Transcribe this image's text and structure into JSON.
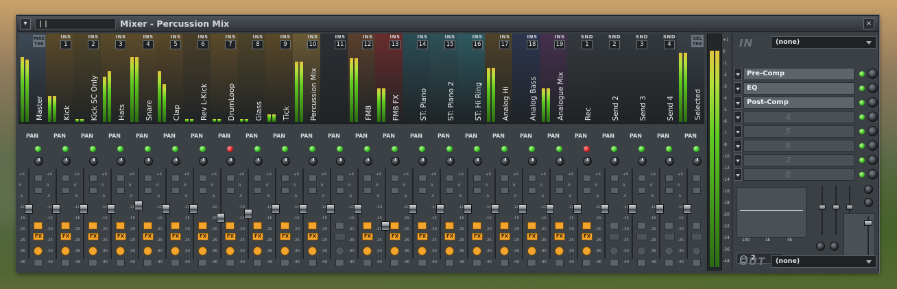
{
  "window": {
    "title": "Mixer - Percussion Mix",
    "close_icon": "×",
    "menu_icon": "▾"
  },
  "labels": {
    "pan": "PAN",
    "ins": "INS",
    "snd": "SND",
    "fx": "FX",
    "master_tag": "MAS TER",
    "sel_tag": "SEL TRK"
  },
  "colors": {
    "accent_orange": "#f2a42d",
    "meter_green": "#5fcb20",
    "led_green": "#2fb81a",
    "led_red": "#d61a1a"
  },
  "channels": [
    {
      "name": "Master",
      "tag": "MAS TER",
      "num": "",
      "color": "#3d4a55",
      "led": "green",
      "fader": 0.56,
      "fx": true,
      "meter": [
        0.86,
        0.83
      ]
    },
    {
      "name": "Kick",
      "tag": "INS",
      "num": "1",
      "color": "#5c4a2a",
      "led": "green",
      "fader": 0.56,
      "fx": true,
      "meter": [
        0.35,
        0.35
      ]
    },
    {
      "name": "Kick SC Only",
      "tag": "INS",
      "num": "2",
      "color": "#4f4528",
      "led": "green",
      "fader": 0.56,
      "fx": true,
      "meter": [
        0.04,
        0.04
      ]
    },
    {
      "name": "Hats",
      "tag": "INS",
      "num": "3",
      "color": "#5a4a28",
      "led": "green",
      "fader": 0.56,
      "fx": true,
      "meter": [
        0.6,
        0.67
      ]
    },
    {
      "name": "Snare",
      "tag": "INS",
      "num": "4",
      "color": "#5d4b2a",
      "led": "green",
      "fader": 0.6,
      "fx": true,
      "meter": [
        0.86,
        0.86
      ]
    },
    {
      "name": "Clap",
      "tag": "INS",
      "num": "5",
      "color": "#5a4828",
      "led": "green",
      "fader": 0.56,
      "fx": true,
      "meter": [
        0.67,
        0.5
      ]
    },
    {
      "name": "Rev L-Kick",
      "tag": "INS",
      "num": "6",
      "color": "#4a3f28",
      "led": "green",
      "fader": 0.56,
      "fx": true,
      "meter": [
        0.04,
        0.04
      ]
    },
    {
      "name": "DrumLoop",
      "tag": "INS",
      "num": "7",
      "color": "#5c4a2a",
      "led": "red",
      "fader": 0.45,
      "fx": true,
      "meter": [
        0.04,
        0.04
      ]
    },
    {
      "name": "Glass",
      "tag": "INS",
      "num": "8",
      "color": "#4d4428",
      "led": "green",
      "fader": 0.5,
      "fx": true,
      "meter": [
        0.04,
        0.04
      ]
    },
    {
      "name": "Tick",
      "tag": "INS",
      "num": "9",
      "color": "#5a4828",
      "led": "green",
      "fader": 0.56,
      "fx": true,
      "meter": [
        0.1,
        0.1
      ]
    },
    {
      "name": "Percussion Mix",
      "tag": "INS",
      "num": "10",
      "color": "#6b5a35",
      "led": "green",
      "fader": 0.56,
      "fx": true,
      "meter": [
        0.8,
        0.8
      ]
    },
    {
      "name": "",
      "tag": "INS",
      "num": "11",
      "color": "#2c3034",
      "led": "green",
      "fader": 0.56,
      "fx": false,
      "meter": [
        0.0,
        0.0
      ]
    },
    {
      "name": "FM8",
      "tag": "INS",
      "num": "12",
      "color": "#5a3f2c",
      "led": "green",
      "fader": 0.56,
      "fx": true,
      "meter": [
        0.85,
        0.85
      ]
    },
    {
      "name": "FM8 FX",
      "tag": "INS",
      "num": "13",
      "color": "#6a2c2c",
      "led": "green",
      "fader": 0.35,
      "fx": true,
      "meter": [
        0.45,
        0.45
      ]
    },
    {
      "name": "ST: Piano",
      "tag": "INS",
      "num": "14",
      "color": "#2b4d55",
      "led": "green",
      "fader": 0.56,
      "fx": true,
      "meter": [
        0.0,
        0.0
      ]
    },
    {
      "name": "ST: Piano 2",
      "tag": "INS",
      "num": "15",
      "color": "#2e5258",
      "led": "green",
      "fader": 0.56,
      "fx": true,
      "meter": [
        0.0,
        0.0
      ]
    },
    {
      "name": "ST: Hi Ring",
      "tag": "INS",
      "num": "16",
      "color": "#2e5a60",
      "led": "green",
      "fader": 0.56,
      "fx": true,
      "meter": [
        0.0,
        0.0
      ]
    },
    {
      "name": "Analog Hi",
      "tag": "INS",
      "num": "17",
      "color": "#4e4228",
      "led": "green",
      "fader": 0.56,
      "fx": true,
      "meter": [
        0.72,
        0.72
      ]
    },
    {
      "name": "Analog Bass",
      "tag": "INS",
      "num": "18",
      "color": "#2d3550",
      "led": "green",
      "fader": 0.56,
      "fx": true,
      "meter": [
        0.0,
        0.0
      ]
    },
    {
      "name": "Analogue Mix",
      "tag": "INS",
      "num": "19",
      "color": "#46304e",
      "led": "green",
      "fader": 0.56,
      "fx": true,
      "meter": [
        0.45,
        0.45
      ]
    },
    {
      "name": "Rec",
      "tag": "SND",
      "num": "1",
      "color": "#34393d",
      "led": "red",
      "fader": 0.56,
      "fx": true,
      "meter": [
        0.0,
        0.0
      ]
    },
    {
      "name": "Send 2",
      "tag": "SND",
      "num": "2",
      "color": "#33383c",
      "led": "green",
      "fader": 0.56,
      "fx": false,
      "meter": [
        0.0,
        0.0
      ]
    },
    {
      "name": "Send 3",
      "tag": "SND",
      "num": "3",
      "color": "#33383c",
      "led": "green",
      "fader": 0.56,
      "fx": false,
      "meter": [
        0.0,
        0.0
      ]
    },
    {
      "name": "Send 4",
      "tag": "SND",
      "num": "4",
      "color": "#33383c",
      "led": "green",
      "fader": 0.56,
      "fx": false,
      "meter": [
        0.0,
        0.0
      ]
    },
    {
      "name": "Selected",
      "tag": "SEL TRK",
      "num": "",
      "color": "#3a4046",
      "led": "green",
      "fader": 0.56,
      "fx": false,
      "meter": [
        0.92,
        0.92
      ]
    }
  ],
  "scale": [
    "+5",
    "0",
    "-5",
    "-10",
    "-15",
    "-20",
    "-25",
    "-30",
    "-40"
  ],
  "master_scale": [
    "+1",
    "0",
    "-1",
    "-2",
    "-3",
    "-4",
    "-5",
    "-6",
    "-7",
    "-8",
    "-10",
    "-12",
    "-14",
    "-16",
    "-18",
    "-20",
    "-22",
    "-24",
    "-36",
    "-48"
  ],
  "master_meter": 0.92,
  "rpanel": {
    "in_label": "IN",
    "in_value": "(none)",
    "out_label": "OUT",
    "out_value": "(none)",
    "slots": [
      {
        "label": "Pre-Comp",
        "empty": false
      },
      {
        "label": "EQ",
        "empty": false
      },
      {
        "label": "Post-Comp",
        "empty": false
      },
      {
        "label": "4",
        "empty": true
      },
      {
        "label": "5",
        "empty": true
      },
      {
        "label": "6",
        "empty": true
      },
      {
        "label": "7",
        "empty": true
      },
      {
        "label": "8",
        "empty": true
      }
    ],
    "eq_labels": [
      "100",
      "1k",
      "5k"
    ],
    "stepper_value": "2"
  }
}
